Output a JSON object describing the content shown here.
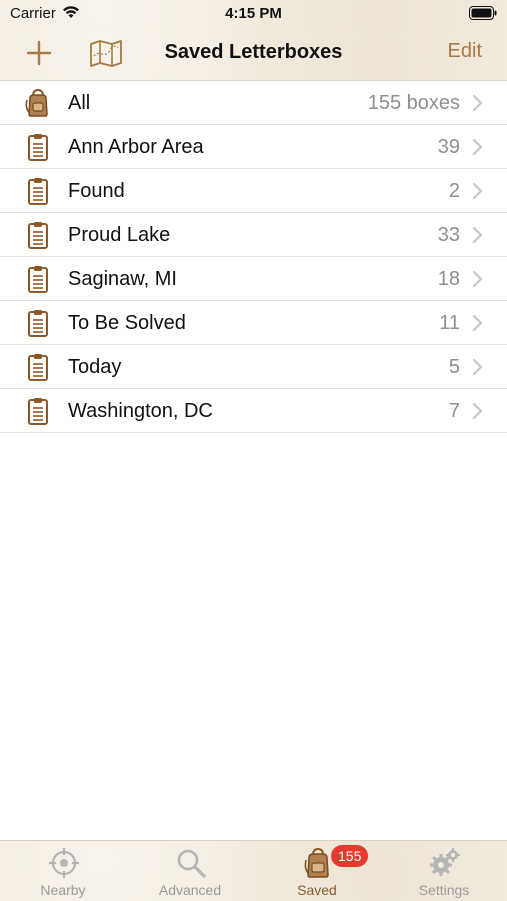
{
  "status_bar": {
    "carrier": "Carrier",
    "time": "4:15 PM"
  },
  "nav": {
    "title": "Saved Letterboxes",
    "edit_label": "Edit"
  },
  "list": {
    "items": [
      {
        "label": "All",
        "count": "155 boxes",
        "icon": "backpack-icon"
      },
      {
        "label": "Ann Arbor Area",
        "count": "39",
        "icon": "clipboard-icon"
      },
      {
        "label": "Found",
        "count": "2",
        "icon": "clipboard-icon"
      },
      {
        "label": "Proud Lake",
        "count": "33",
        "icon": "clipboard-icon"
      },
      {
        "label": "Saginaw, MI",
        "count": "18",
        "icon": "clipboard-icon"
      },
      {
        "label": "To Be Solved",
        "count": "11",
        "icon": "clipboard-icon"
      },
      {
        "label": "Today",
        "count": "5",
        "icon": "clipboard-icon"
      },
      {
        "label": "Washington, DC",
        "count": "7",
        "icon": "clipboard-icon"
      }
    ]
  },
  "tab_bar": {
    "tabs": [
      {
        "label": "Nearby",
        "icon": "crosshair-icon"
      },
      {
        "label": "Advanced",
        "icon": "magnifier-icon"
      },
      {
        "label": "Saved",
        "icon": "backpack-icon",
        "badge": "155",
        "active": true
      },
      {
        "label": "Settings",
        "icon": "gears-icon"
      }
    ]
  },
  "colors": {
    "accent": "#a57a45",
    "icon_brown": "#8a5a2b",
    "badge_red": "#e8392f",
    "parchment": "#f3ece0"
  }
}
